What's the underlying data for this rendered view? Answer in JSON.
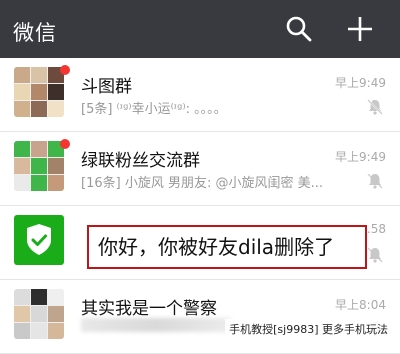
{
  "header": {
    "title": "微信"
  },
  "chats": [
    {
      "name": "斗图群",
      "preview": "[5条] ⁽ᶦᵍ⁾幸小运⁽ᶦᵍ⁾: 。。。。",
      "time": "早上9:49",
      "unread_dot": true,
      "muted": true
    },
    {
      "name": "绿联粉丝交流群",
      "preview": "[16条] 小旋风 男朋友: @小旋风闺密 美...",
      "time": "早上9:49",
      "unread_dot": true,
      "muted": true
    },
    {
      "name": "",
      "preview": "",
      "time": "...58",
      "unread_dot": false,
      "muted": true
    },
    {
      "name": "其实我是一个警察",
      "preview": "",
      "time": "早上8:04",
      "unread_dot": false,
      "muted": true
    }
  ],
  "callout": {
    "text": "你好，你被好友dila删除了"
  },
  "watermark": {
    "text": "手机教授[sj9983] 更多手机玩法"
  },
  "colors": {
    "topbar": "#393a3f",
    "accent_green": "#1aad19",
    "badge_red": "#f43530",
    "callout_border": "#c0141a"
  }
}
